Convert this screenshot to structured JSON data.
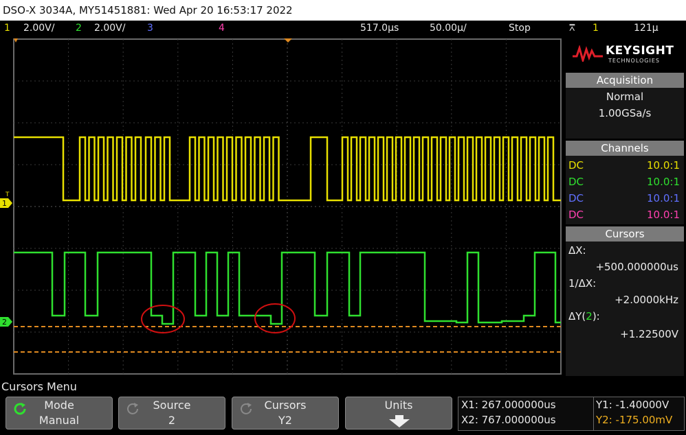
{
  "title": "DSO-X 3034A, MY51451881: Wed Apr 20 16:53:17 2022",
  "status": {
    "ch1_num": "1",
    "ch1_scale": "2.00V/",
    "ch2_num": "2",
    "ch2_scale": "2.00V/",
    "ch3_num": "3",
    "ch4_num": "4",
    "timebase_delay": "517.0µs",
    "timebase_scale": "50.00µ/",
    "run_state": "Stop",
    "trigger_icon": "trigger-edge-icon",
    "trigger_source": "1",
    "trigger_level": "121µ"
  },
  "brand": {
    "name": "KEYSIGHT",
    "sub": "TECHNOLOGIES"
  },
  "acquisition": {
    "header": "Acquisition",
    "mode": "Normal",
    "rate": "1.00GSa/s"
  },
  "channels": {
    "header": "Channels",
    "rows": [
      {
        "coupling": "DC",
        "probe": "10.0:1",
        "color": "#e8e000"
      },
      {
        "coupling": "DC",
        "probe": "10.0:1",
        "color": "#2fe02f"
      },
      {
        "coupling": "DC",
        "probe": "10.0:1",
        "color": "#6070ff"
      },
      {
        "coupling": "DC",
        "probe": "10.0:1",
        "color": "#ff40b0"
      }
    ]
  },
  "cursors_panel": {
    "header": "Cursors",
    "dx_label": "ΔX:",
    "dx_value": "+500.000000us",
    "inv_dx_label": "1/ΔX:",
    "inv_dx_value": "+2.0000kHz",
    "dy_label_pre": "ΔY(",
    "dy_label_ch": "2",
    "dy_label_post": "):",
    "dy_value": "+1.22500V"
  },
  "menu": {
    "title": "Cursors Menu",
    "softkeys": [
      {
        "top": "Mode",
        "bottom": "Manual"
      },
      {
        "top": "Source",
        "bottom": "2"
      },
      {
        "top": "Cursors",
        "bottom": "Y2"
      },
      {
        "top": "Units",
        "bottom": ""
      }
    ]
  },
  "readout": {
    "x1": "X1: 267.000000us",
    "x2": "X2: 767.000000us",
    "y1": "Y1: -1.40000V",
    "y2": "Y2: -175.00mV"
  },
  "markers": {
    "ch1": "1",
    "ch2": "2",
    "trig_t": "T"
  },
  "colors": {
    "ch1": "#e8e000",
    "ch2": "#2fe02f",
    "ch3": "#6070ff",
    "ch4": "#ff40b0",
    "cursor": "#e08a20",
    "annotation": "#d01010",
    "grid": "#3a3a3a"
  }
}
